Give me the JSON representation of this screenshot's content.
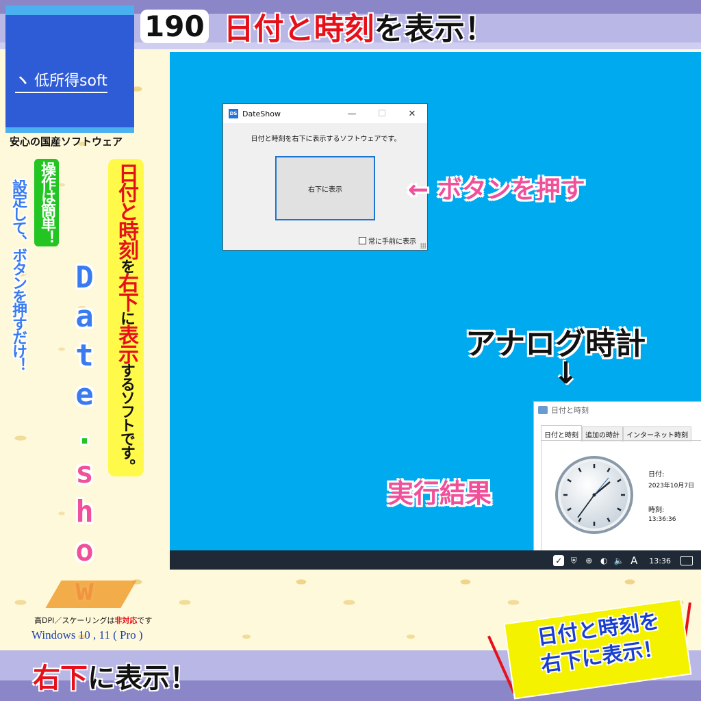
{
  "banner": {
    "number": "190",
    "title_red": "日付と時刻",
    "title_black": "を表示！"
  },
  "logo": {
    "mark": "ヽ",
    "name": "低所得soft",
    "tagline": "安心の国産ソフトウェア"
  },
  "left_panel": {
    "setting_text": "設定して、ボタンを押すだけ！",
    "easy_text": "操作は簡単！",
    "app_name_blue1": "Date",
    "app_name_dot": ".",
    "app_name_pink": "show",
    "desc_red1": "日付と時刻",
    "desc_small1": "を",
    "desc_red2": "右下",
    "desc_small2": "に",
    "desc_red3": "表示",
    "desc_small3": "するソフトです。",
    "compat_prefix": "高DPI／スケーリングは",
    "compat_red": "非対応",
    "compat_suffix": "です",
    "os": "Windows 10 , 11 ( Pro )"
  },
  "window": {
    "icon": "DS",
    "title": "DateShow",
    "minimize": "—",
    "maximize": "☐",
    "close": "✕",
    "message": "日付と時刻を右下に表示するソフトウェアです。",
    "button_label": "右下に表示",
    "checkbox_label": "常に手前に表示",
    "checkbox_checked": false
  },
  "annotations": {
    "push_button": "← ボタンを押す",
    "analog_clock": "アナログ時計",
    "down_arrow": "↓",
    "result": "実行結果"
  },
  "dialog": {
    "title": "日付と時刻",
    "tabs": [
      "日付と時刻",
      "追加の時計",
      "インターネット時刻"
    ],
    "date_label": "日付:",
    "date_value": "2023年10月7日",
    "time_label": "時刻:",
    "time_value": "13:36:36"
  },
  "taskbar": {
    "icons": [
      "app-icon",
      "shield-icon",
      "globe-icon",
      "network-icon",
      "volume-icon"
    ],
    "ime": "A",
    "time": "13:36"
  },
  "bottom": {
    "title_red": "右下",
    "title_black": "に表示！",
    "badge_line1": "日付と時刻を",
    "badge_line2": "右下に表示！"
  },
  "colors": {
    "desktop": "#00aaee",
    "accent_red": "#e6101a",
    "accent_pink": "#f0509a",
    "logo_blue": "#2e5bd6"
  }
}
